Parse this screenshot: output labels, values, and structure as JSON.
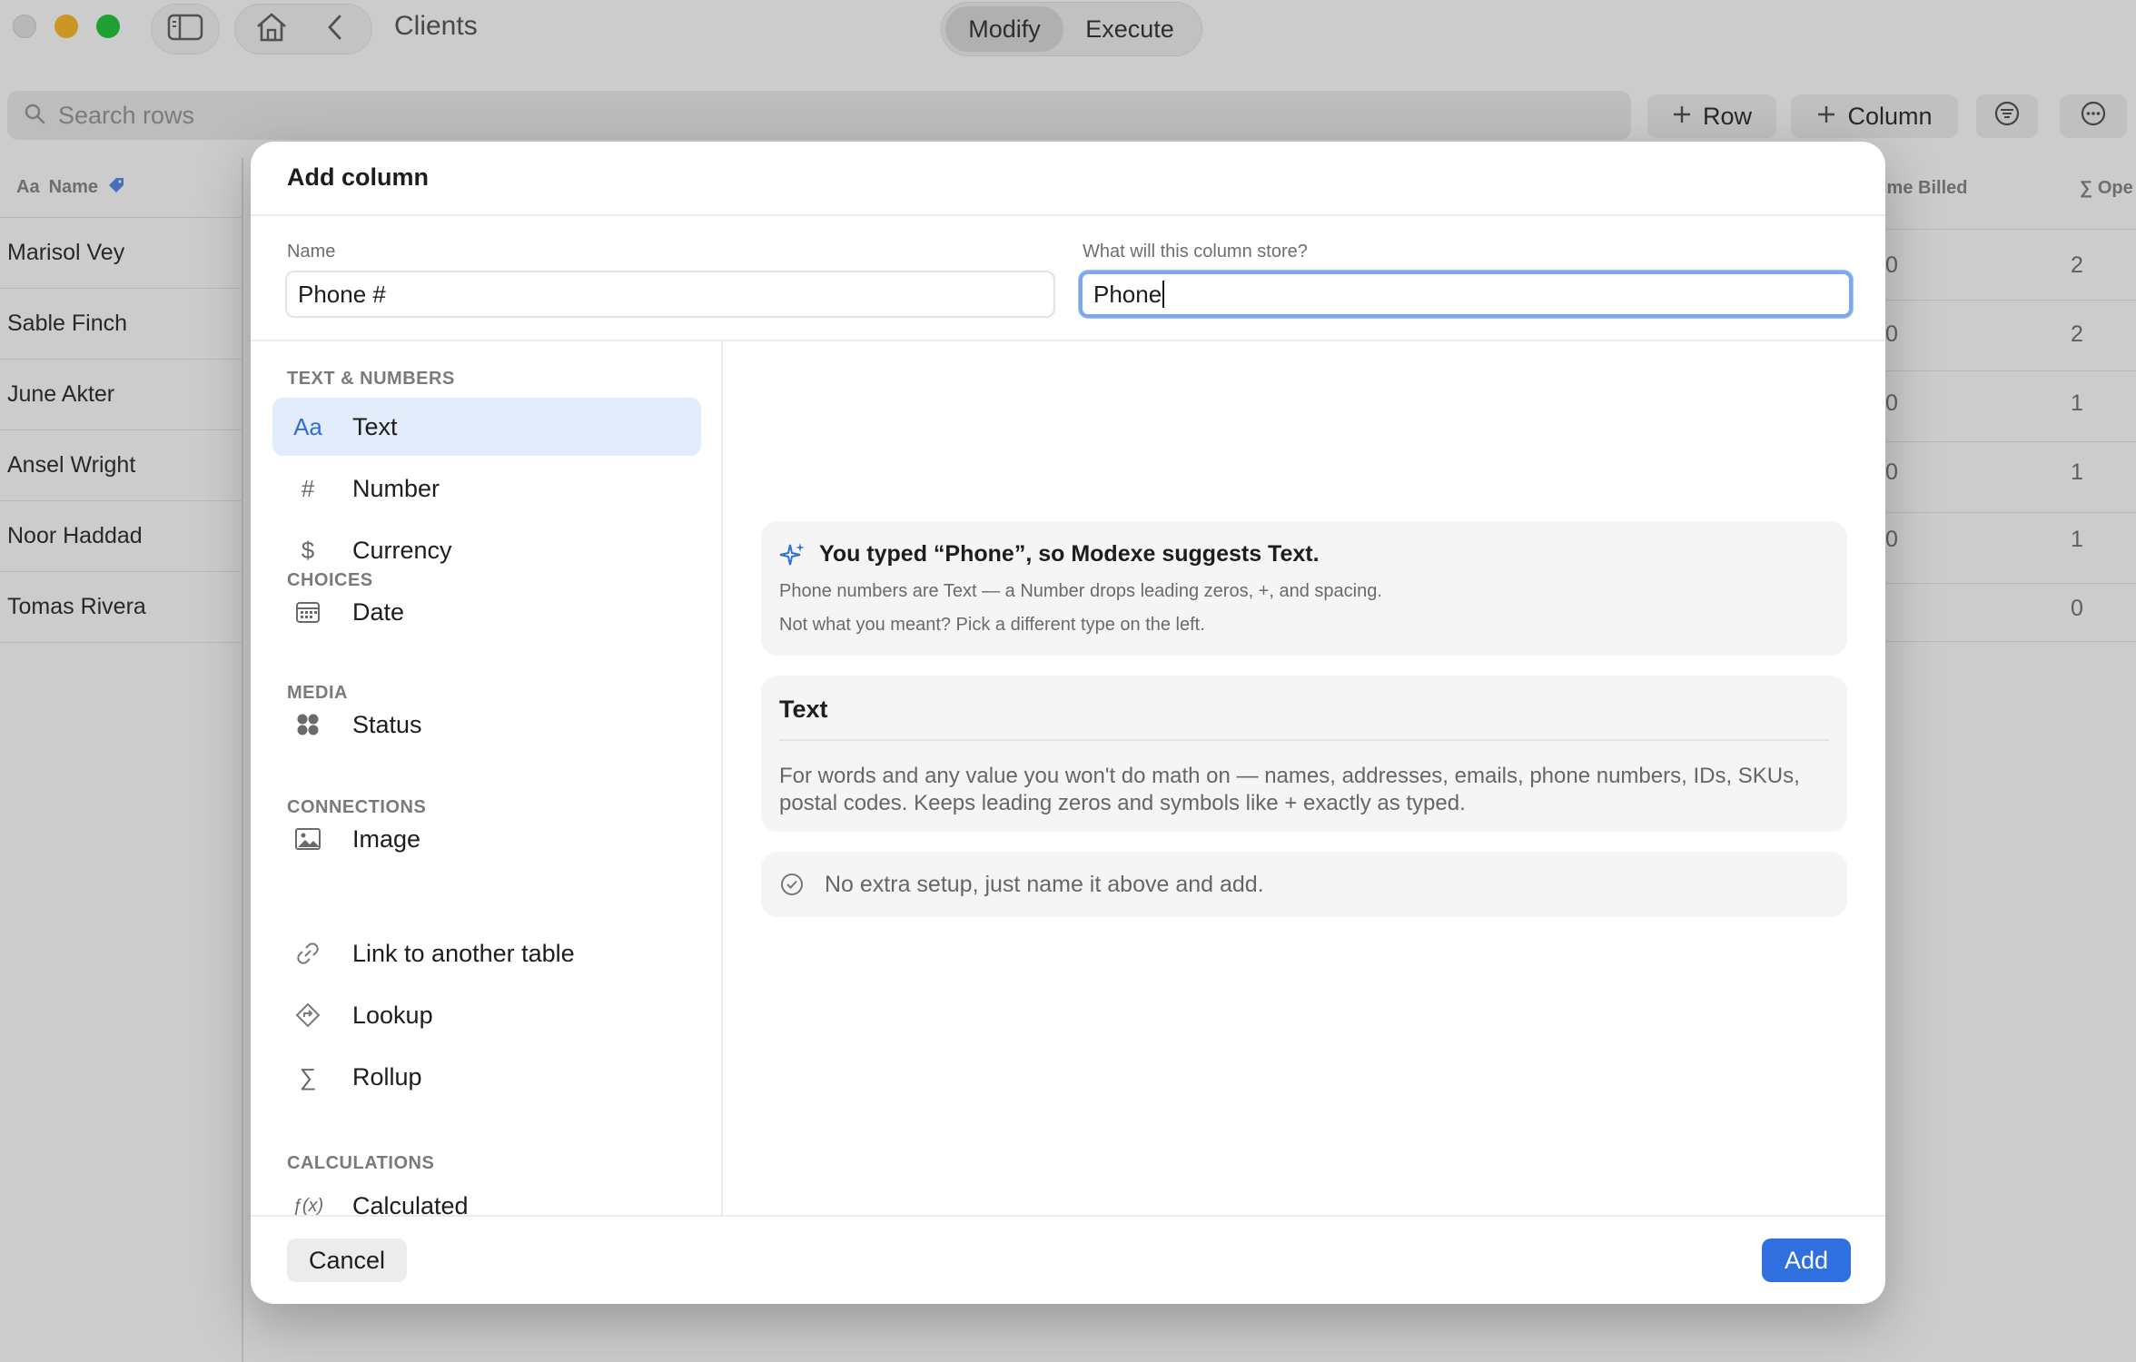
{
  "window": {
    "title": "Clients",
    "mode_tabs": [
      "Modify",
      "Execute"
    ],
    "active_mode": "Modify"
  },
  "toolbar": {
    "search_placeholder": "Search rows",
    "add_row_label": "Row",
    "add_column_label": "Column"
  },
  "table": {
    "name_column_header": "Name",
    "name_column_icon_text": "Aa",
    "rows": [
      "Marisol Vey",
      "Sable Finch",
      "June Akter",
      "Ansel Wright",
      "Noor Haddad",
      "Tomas Rivera"
    ],
    "partial_col_1_header": "ime Billed",
    "partial_col_2_header": "∑ Ope",
    "partial_col_1_values": [
      "0",
      "0",
      "0",
      "0",
      "0",
      ""
    ],
    "partial_col_2_values": [
      "2",
      "2",
      "1",
      "1",
      "1",
      "0"
    ]
  },
  "dialog": {
    "title": "Add column",
    "name_label": "Name",
    "name_value": "Phone #",
    "store_label": "What will this column store?",
    "store_value": "Phone",
    "sections": {
      "text_numbers": "TEXT & NUMBERS",
      "choices": "CHOICES",
      "media": "MEDIA",
      "connections": "CONNECTIONS",
      "calculations": "CALCULATIONS"
    },
    "types": {
      "text": {
        "icon_text": "Aa",
        "label": "Text",
        "icon": "text-type-icon"
      },
      "number": {
        "icon_text": "#",
        "label": "Number",
        "icon": "number-type-icon"
      },
      "currency": {
        "icon_text": "$",
        "label": "Currency",
        "icon": "currency-type-icon"
      },
      "date": {
        "label": "Date",
        "icon": "calendar-icon"
      },
      "status": {
        "label": "Status",
        "icon": "status-dots-icon"
      },
      "image": {
        "label": "Image",
        "icon": "image-icon"
      },
      "link": {
        "label": "Link to another table",
        "icon": "link-icon"
      },
      "lookup": {
        "label": "Lookup",
        "icon": "lookup-icon"
      },
      "rollup": {
        "icon_text": "∑",
        "label": "Rollup",
        "icon": "sigma-icon"
      },
      "calculated": {
        "icon_text": "ƒ(x)",
        "label": "Calculated",
        "icon": "function-icon"
      }
    },
    "selected_type": "Text",
    "suggestion": {
      "title": "You typed “Phone”, so Modexe suggests Text.",
      "line1": "Phone numbers are Text — a Number drops leading zeros, +, and spacing.",
      "line2": "Not what you meant? Pick a different type on the left."
    },
    "type_detail": {
      "title": "Text",
      "description": "For words and any value you won't do math on — names, addresses, emails, phone numbers, IDs, SKUs, postal codes. Keeps leading zeros and symbols like + exactly as typed."
    },
    "setup_note": "No extra setup, just name it above and add.",
    "cancel_label": "Cancel",
    "add_label": "Add"
  },
  "colors": {
    "accent": "#2f6fe0",
    "selected_row_bg": "#e3ecfb",
    "focus_ring": "#7fa8ea"
  }
}
